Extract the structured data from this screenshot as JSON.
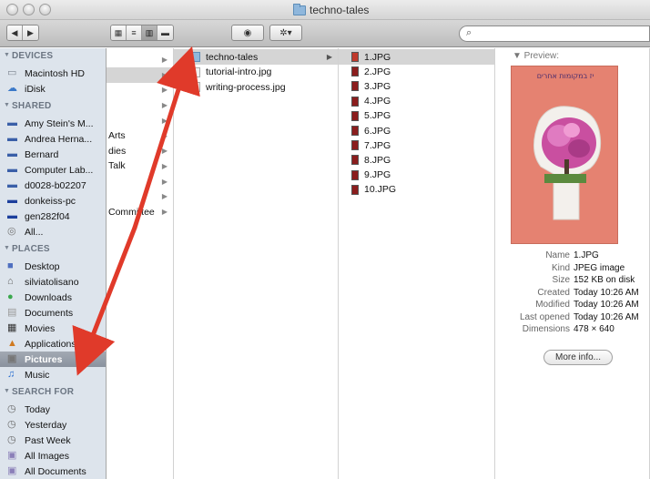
{
  "window": {
    "title": "techno-tales"
  },
  "toolbar": {
    "back": "◀",
    "forward": "▶",
    "view_icons": "▦",
    "view_list": "≡",
    "view_columns": "▥",
    "view_coverflow": "▬",
    "quicklook": "◉",
    "action": "✲▾",
    "search_placeholder": ""
  },
  "sidebar": {
    "devices_header": "DEVICES",
    "devices": [
      {
        "label": "Macintosh HD",
        "icon": "hard-drive-icon"
      },
      {
        "label": "iDisk",
        "icon": "idisk-icon"
      }
    ],
    "shared_header": "SHARED",
    "shared": [
      {
        "label": "Amy Stein's M...",
        "icon": "computer-icon"
      },
      {
        "label": "Andrea Herna...",
        "icon": "computer-icon"
      },
      {
        "label": "Bernard",
        "icon": "computer-icon"
      },
      {
        "label": "Computer Lab...",
        "icon": "computer-icon"
      },
      {
        "label": "d0028-b02207",
        "icon": "computer-icon"
      },
      {
        "label": "donkeiss-pc",
        "icon": "pc-icon"
      },
      {
        "label": "gen282f04",
        "icon": "pc-icon"
      },
      {
        "label": "All...",
        "icon": "network-icon"
      }
    ],
    "places_header": "PLACES",
    "places": [
      {
        "label": "Desktop",
        "icon": "desktop-icon"
      },
      {
        "label": "silviatolisano",
        "icon": "home-icon"
      },
      {
        "label": "Downloads",
        "icon": "downloads-icon"
      },
      {
        "label": "Documents",
        "icon": "documents-icon"
      },
      {
        "label": "Movies",
        "icon": "movies-icon"
      },
      {
        "label": "Applications",
        "icon": "applications-icon"
      },
      {
        "label": "Pictures",
        "icon": "pictures-icon"
      },
      {
        "label": "Music",
        "icon": "music-icon"
      }
    ],
    "search_header": "SEARCH FOR",
    "search": [
      {
        "label": "Today",
        "icon": "clock-icon"
      },
      {
        "label": "Yesterday",
        "icon": "clock-icon"
      },
      {
        "label": "Past Week",
        "icon": "clock-icon"
      },
      {
        "label": "All Images",
        "icon": "smart-folder-icon"
      },
      {
        "label": "All Documents",
        "icon": "smart-folder-icon"
      }
    ]
  },
  "column1": {
    "items": [
      "",
      "",
      "",
      "",
      "",
      "Arts",
      "dies",
      "Talk",
      "",
      "",
      "Committee"
    ]
  },
  "column2": {
    "items": [
      {
        "label": "techno-tales",
        "kind": "folder"
      },
      {
        "label": "tutorial-intro.jpg",
        "kind": "file"
      },
      {
        "label": "writing-process.jpg",
        "kind": "file"
      }
    ]
  },
  "column3": {
    "items": [
      "1.JPG",
      "2.JPG",
      "3.JPG",
      "4.JPG",
      "5.JPG",
      "6.JPG",
      "7.JPG",
      "8.JPG",
      "9.JPG",
      "10.JPG"
    ]
  },
  "preview": {
    "label": "▼ Preview:",
    "handwriting": "יז במקומות אחרים",
    "info": [
      {
        "k": "Name",
        "v": "1.JPG"
      },
      {
        "k": "Kind",
        "v": "JPEG image"
      },
      {
        "k": "Size",
        "v": "152 KB on disk"
      },
      {
        "k": "Created",
        "v": "Today 10:26 AM"
      },
      {
        "k": "Modified",
        "v": "Today 10:26 AM"
      },
      {
        "k": "Last opened",
        "v": "Today 10:26 AM"
      },
      {
        "k": "Dimensions",
        "v": "478 × 640"
      }
    ],
    "more_info": "More info..."
  },
  "colors": {
    "annotation_arrow": "#e03a2a",
    "sidebar_bg": "#dde4ec",
    "selection": "#8a929e"
  }
}
